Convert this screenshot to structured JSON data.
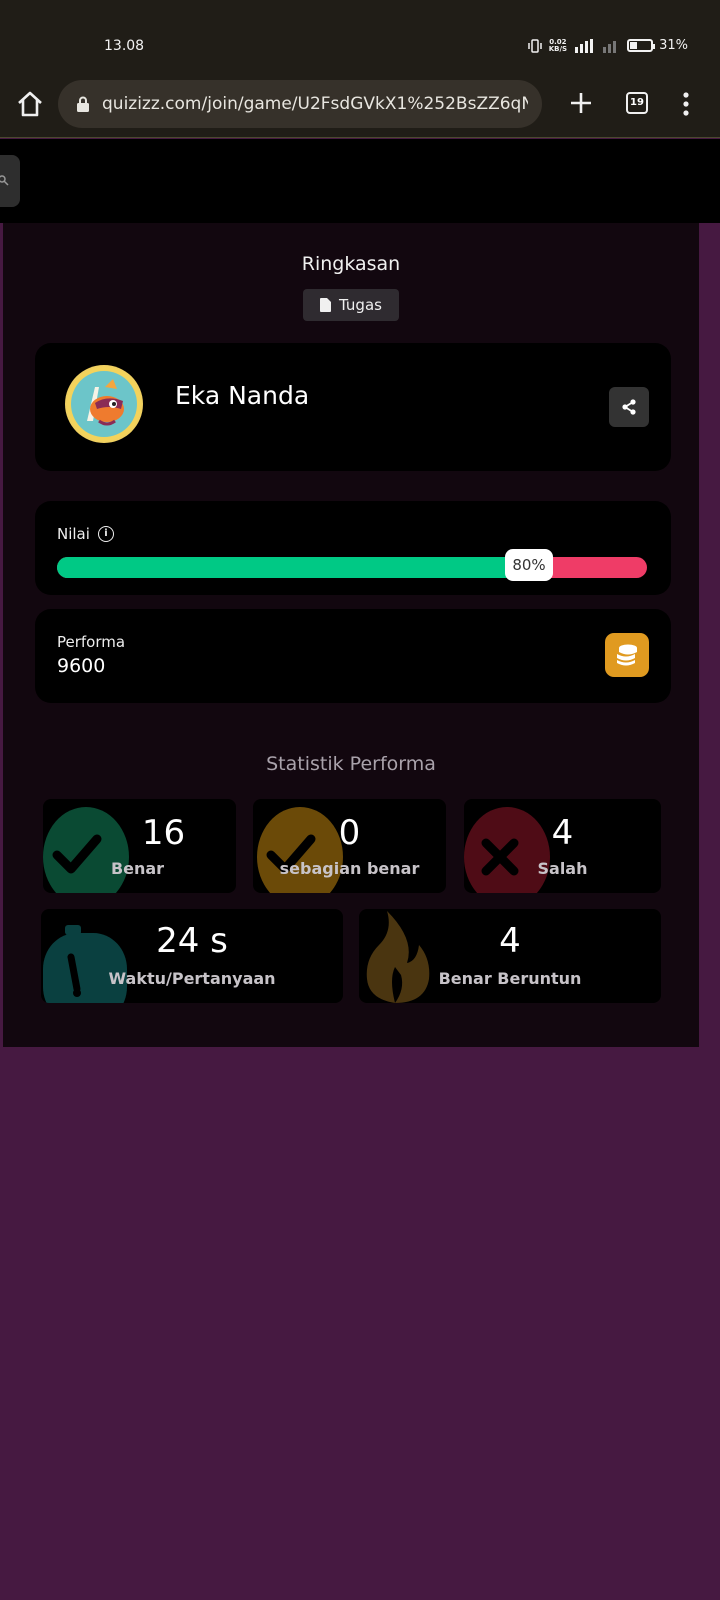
{
  "status_bar": {
    "time": "13.08",
    "data_rate": "0.02",
    "data_unit": "KB/S",
    "network": "4G",
    "battery": "31%"
  },
  "browser": {
    "url": "quizizz.com/join/game/U2FsdGVkX1%252BsZZ6qNQr%",
    "tab_count": "19"
  },
  "summary": {
    "title": "Ringkasan",
    "tag_label": "Tugas"
  },
  "player": {
    "name": "Eka Nanda"
  },
  "score": {
    "label": "Nilai",
    "percent_text": "80%",
    "percent": 80,
    "correct_color": "#00c985",
    "incorrect_color": "#ef3c67"
  },
  "performance": {
    "label": "Performa",
    "value": "9600"
  },
  "stats": {
    "title": "Statistik Performa",
    "correct": {
      "value": "16",
      "label": "Benar"
    },
    "partial": {
      "value": "0",
      "label": "sebagian benar"
    },
    "incorrect": {
      "value": "4",
      "label": "Salah"
    },
    "time": {
      "value": "24 s",
      "label": "Waktu/Pertanyaan"
    },
    "streak": {
      "value": "4",
      "label": "Benar Beruntun"
    }
  }
}
